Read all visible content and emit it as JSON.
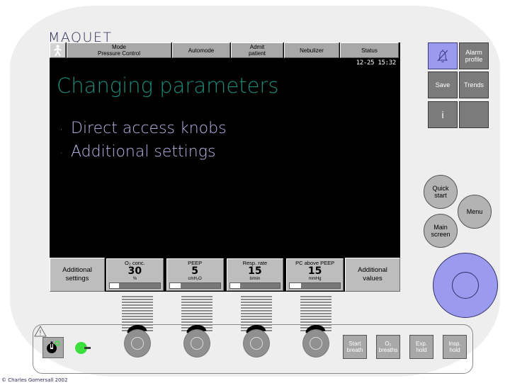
{
  "brand": "MAQUET",
  "menubar": {
    "patient_icon": "patient-figure-icon",
    "mode_label": "Mode",
    "mode_value": "Pressure Control",
    "automode": "Automode",
    "admit_patient_line1": "Admit",
    "admit_patient_line2": "patient",
    "nebulizer": "Nebulizer",
    "status": "Status"
  },
  "clock": "12-25 15:32",
  "slide": {
    "title": "Changing parameters",
    "bullet_char": "·",
    "bullets": [
      "Direct access knobs",
      "Additional settings"
    ]
  },
  "param_strip": {
    "left_button_line1": "Additional",
    "left_button_line2": "settings",
    "right_button_line1": "Additional",
    "right_button_line2": "values",
    "parameters": [
      {
        "label": "O₂ conc.",
        "value": "30",
        "unit": "%",
        "fill_percent": 18
      },
      {
        "label": "PEEP",
        "value": "5",
        "unit": "cmH₂O",
        "fill_percent": 22
      },
      {
        "label": "Resp. rate",
        "value": "15",
        "unit": "b/min",
        "fill_percent": 20
      },
      {
        "label": "PC above PEEP",
        "value": "15",
        "unit": "mmHg",
        "fill_percent": 22
      }
    ]
  },
  "right_cluster": {
    "alarm_silence_icon": "bell-slash-icon",
    "alarm_profile_line1": "Alarm",
    "alarm_profile_line2": "profile",
    "save": "Save",
    "trends": "Trends",
    "info": "i",
    "blank": ""
  },
  "nav_buttons": {
    "quick_start_line1": "Quick",
    "quick_start_line2": "start",
    "menu": "Menu",
    "main_screen_line1": "Main",
    "main_screen_line2": "screen"
  },
  "bottom_panel": {
    "warning_icon": "warning-triangle-icon",
    "power_icon": "power-icon",
    "power_led": "power-led-green",
    "actions": [
      {
        "line1": "Start",
        "line2": "breath"
      },
      {
        "line1": "O₂",
        "line2": "breaths"
      },
      {
        "line1": "Exp.",
        "line2": "hold"
      },
      {
        "line1": "Insp.",
        "line2": "hold"
      }
    ]
  },
  "colors": {
    "screen_bg": "#000000",
    "title_teal": "#1e8a7a",
    "bullet_lavender": "#b9b6e8",
    "accent_periwinkle": "#9a9aee",
    "device_gray": "#eeeeee",
    "button_gray": "#bdbdbd",
    "led_green": "#3ce03c"
  },
  "copyright": "© Charles Gomersall 2002"
}
